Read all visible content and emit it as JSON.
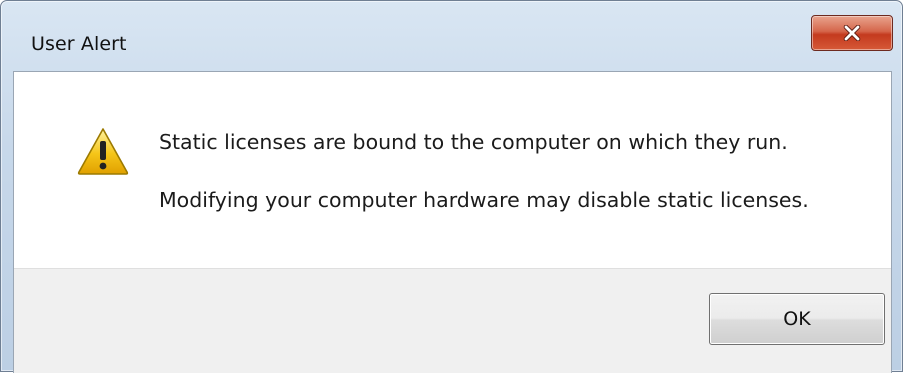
{
  "window": {
    "title": "User Alert",
    "close_icon": "close-icon"
  },
  "message": {
    "icon": "warning-icon",
    "line1": "Static licenses are bound to the computer on which they run.",
    "line2": "Modifying your computer hardware may disable static licenses."
  },
  "buttons": {
    "ok_label": "OK"
  },
  "colors": {
    "close_button": "#c43a1e",
    "warning_fill": "#f5c518",
    "footer_bg": "#f0f0f0"
  }
}
